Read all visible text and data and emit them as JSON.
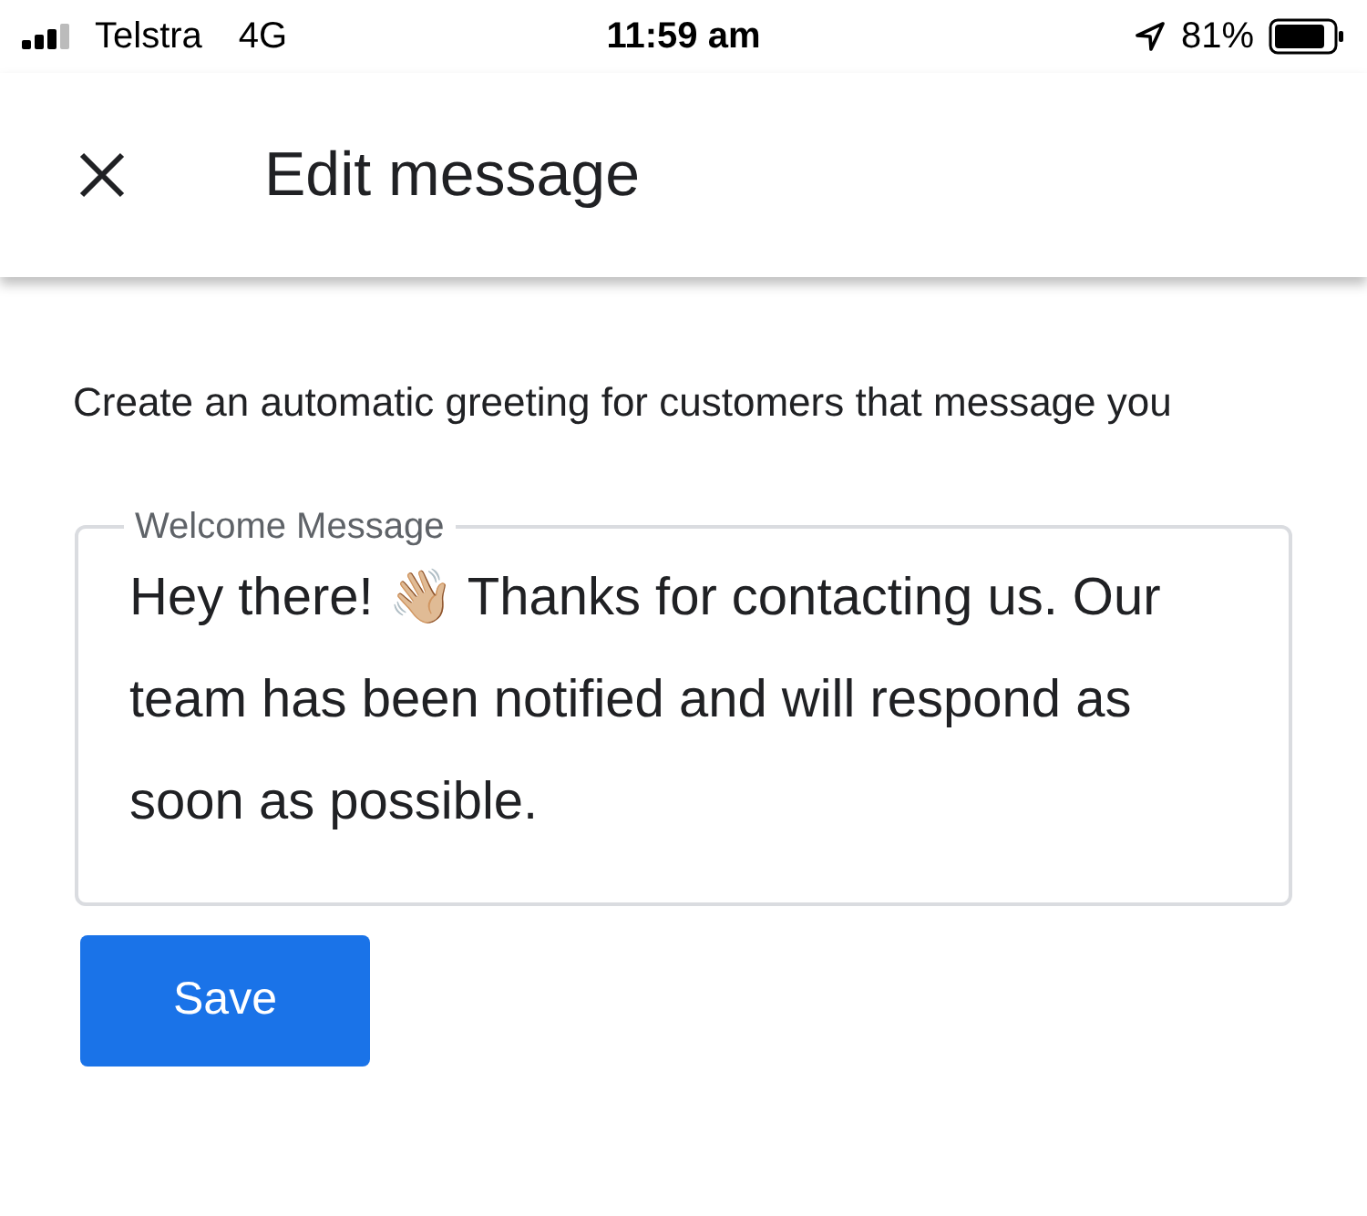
{
  "status_bar": {
    "carrier": "Telstra",
    "network": "4G",
    "time": "11:59 am",
    "battery": "81%"
  },
  "header": {
    "title": "Edit message"
  },
  "description": "Create an automatic greeting for customers that message you",
  "message_field": {
    "label": "Welcome Message",
    "value": "Hey there! 👋🏼 Thanks for contacting us. Our team has been notified and will respond as soon as possible."
  },
  "save_button": {
    "label": "Save"
  }
}
